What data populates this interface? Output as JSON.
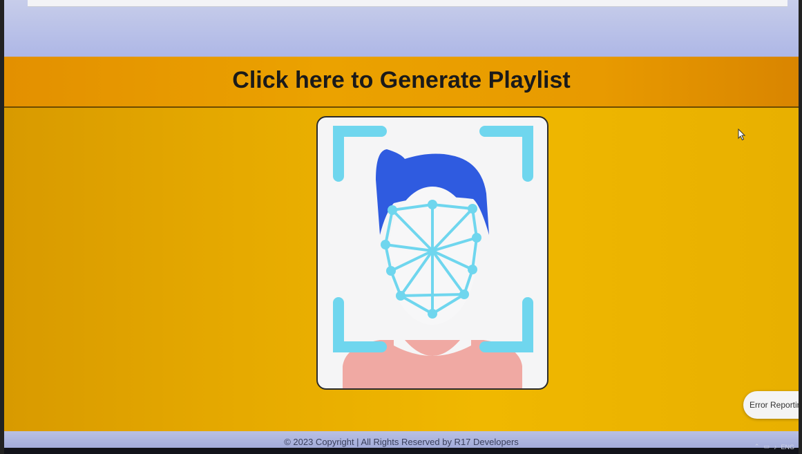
{
  "header": {
    "title": "Click here to Generate Playlist"
  },
  "main": {
    "face_image_icon": "face-scan-icon"
  },
  "error_reporting": {
    "label": "Error Reportir"
  },
  "footer": {
    "text": "© 2023 Copyright | All Rights Reserved by R17 Developers"
  },
  "taskbar": {
    "language": "ENG"
  },
  "colors": {
    "background": "#e9b400",
    "header": "#eba200",
    "hair": "#2f5be0",
    "mesh": "#6fd6ee",
    "shirt": "#f0a9a3"
  }
}
